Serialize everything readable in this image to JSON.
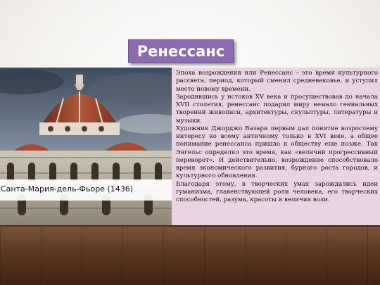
{
  "slide": {
    "title": "Ренессанс",
    "caption": "Санта-Мария-дель-Фьоре (1436)",
    "paragraphs": [
      "Эпоха возрождения или Ренессанс - это время культурного рассвета, период, который сменил средневековье, и уступил место новому времени.",
      "Зародившись у истоков XV века и просуществовав до начала XVII столетия, ренессанс подарил миру немало гениальных творений живописи, архитектуры, скульптуры, литературы и музыки.",
      "Художник Джорджо Вазари первым дал понятие возрослему интересу ко всему античному только в XVI веке, а общее понимание ренессанса пришло к обществу еще позже. Так Энгельс определял это время, как «величий прогрессивный переворот». И действительно, возрождение способствовало время экономического развития, бурного роста городов, и культурного обновления.",
      "Благодаря этому, в творческих умах зарождались идеи гуманизма, главенствующей роли человека, его творческих способностей, разума, красоты и величия воли."
    ]
  },
  "colors": {
    "title_bg": "#8c6bb0",
    "text_panel_bg": "#ead3e2",
    "floor": "#5c3a22"
  }
}
